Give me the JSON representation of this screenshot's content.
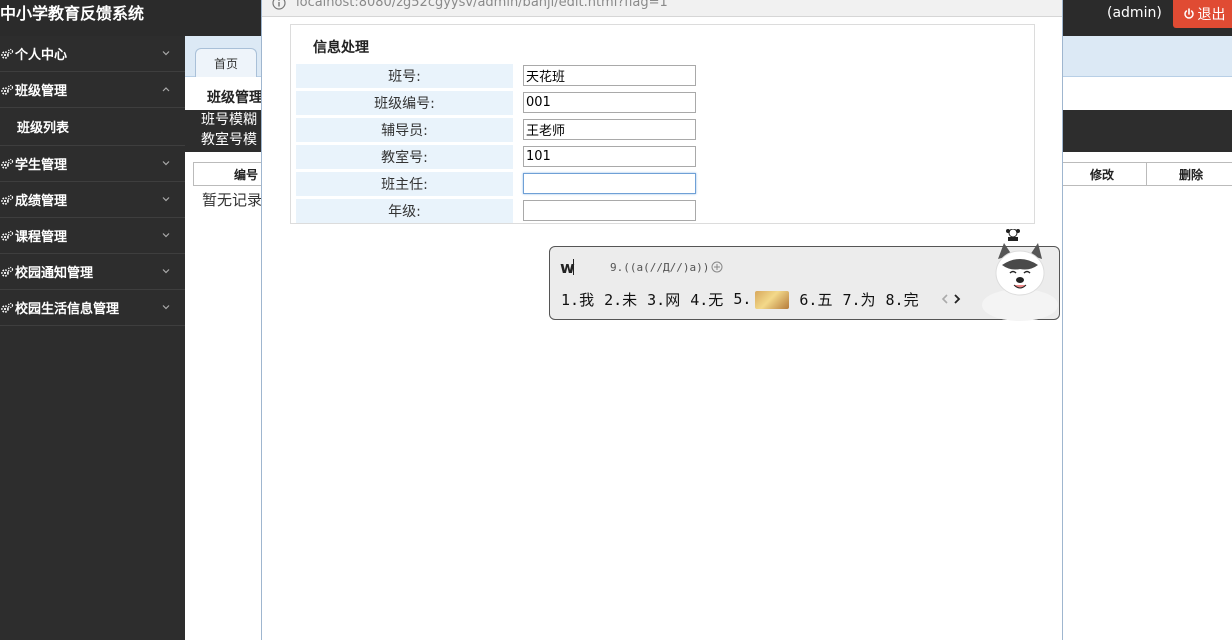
{
  "app": {
    "title": "中小学教育反馈系统",
    "user": "(admin)",
    "logout_label": "退出",
    "accent_color": "#e04b33"
  },
  "sidebar": {
    "items": [
      {
        "label": "个人中心",
        "expanded": false
      },
      {
        "label": "班级管理",
        "expanded": true,
        "children": [
          {
            "label": "班级列表"
          }
        ]
      },
      {
        "label": "学生管理",
        "expanded": false
      },
      {
        "label": "成绩管理",
        "expanded": false
      },
      {
        "label": "课程管理",
        "expanded": false
      },
      {
        "label": "校园通知管理",
        "expanded": false
      },
      {
        "label": "校园生活信息管理",
        "expanded": false
      }
    ],
    "icon": "gear-icon"
  },
  "main": {
    "tab_home": "首页",
    "section_title": "班级管理",
    "search_labels": [
      "班号模糊",
      "教室号模"
    ],
    "grid_headers": {
      "first": "编号",
      "edit": "修改",
      "delete": "删除"
    },
    "empty_text": "暂无记录"
  },
  "modal": {
    "url": "localhost:8080/zg52cgyysv/admin/banji/edit.html?flag=1",
    "heading": "信息处理",
    "fields": [
      {
        "label": "班号:",
        "value": "天花班",
        "focused": false
      },
      {
        "label": "班级编号:",
        "value": "001",
        "focused": false
      },
      {
        "label": "辅导员:",
        "value": "王老师",
        "focused": false
      },
      {
        "label": "教室号:",
        "value": "101",
        "focused": false
      },
      {
        "label": "班主任:",
        "value": "",
        "focused": true
      },
      {
        "label": "年级:",
        "value": "",
        "focused": false
      }
    ]
  },
  "ime": {
    "input": "w",
    "emoticon": "9.((a(//Д//)a))",
    "candidates": [
      {
        "index": "1.",
        "text": "我"
      },
      {
        "index": "2.",
        "text": "未"
      },
      {
        "index": "3.",
        "text": "网"
      },
      {
        "index": "4.",
        "text": "无"
      },
      {
        "index": "5.",
        "text": "",
        "image": true
      },
      {
        "index": "6.",
        "text": "五"
      },
      {
        "index": "7.",
        "text": "为"
      },
      {
        "index": "8.",
        "text": "完"
      }
    ]
  }
}
